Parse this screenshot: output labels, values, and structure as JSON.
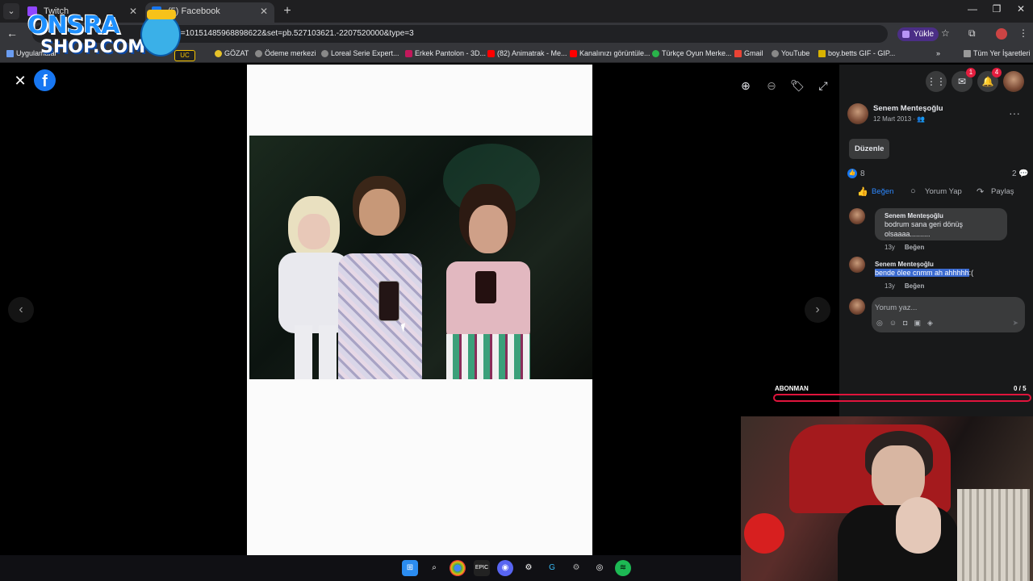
{
  "browser": {
    "tabs": [
      {
        "title": "Twitch",
        "active": false
      },
      {
        "title": "(5) Facebook",
        "active": true
      }
    ],
    "url": "id=10151485968898622&set=pb.527103621.-2207520000&type=3",
    "upload_label": "Yükle",
    "bookmarks": [
      "Uygulamalar",
      "GÖZAT",
      "Ödeme merkezi",
      "Loreal Serie Expert...",
      "Erkek Pantolon - 3D...",
      "(82) Animatrak - Me...",
      "Kanalınızı görüntüle...",
      "Türkçe Oyun Merke...",
      "Gmail",
      "YouTube",
      "boy.betts GIF - GIP..."
    ],
    "all_bookmarks": "Tüm Yer İşaretleri"
  },
  "overlay_logo": {
    "line1": "ONSRA",
    "line2": "SHOP.COM",
    "badge": "UC"
  },
  "viewer": {
    "close_icon": "close-icon",
    "brand": "f",
    "tools": [
      "zoom-in-icon",
      "zoom-out-icon",
      "tag-icon",
      "fullscreen-icon"
    ]
  },
  "post": {
    "author": "Senem Menteşoğlu",
    "date": "12 Mart 2013 · 👥",
    "edit_label": "Düzenle",
    "likes": "8",
    "comment_count": "2",
    "actions": {
      "like": "Beğen",
      "comment": "Yorum Yap",
      "share": "Paylaş"
    },
    "notifications": {
      "messenger": "1",
      "bell": "4"
    }
  },
  "comments": [
    {
      "author": "Senem Menteşoğlu",
      "text": "bodrum sana geri dönüş olsaaaa..........",
      "age": "13y",
      "like": "Beğen"
    },
    {
      "author": "Senem Menteşoğlu",
      "text_selected": "bende ölee cnmm ah ahhhhh",
      "text_rest": ":(",
      "age": "13y",
      "like": "Beğen"
    }
  ],
  "composer": {
    "placeholder": "Yorum yaz..."
  },
  "subgoal": {
    "label": "ABONMAN",
    "count": "0 / 5",
    "progress": 0
  },
  "colors": {
    "fb_blue": "#1877f2",
    "panel_bg": "#18191a",
    "bubble": "#3a3b3c",
    "sub_bar": "#e0143c"
  }
}
